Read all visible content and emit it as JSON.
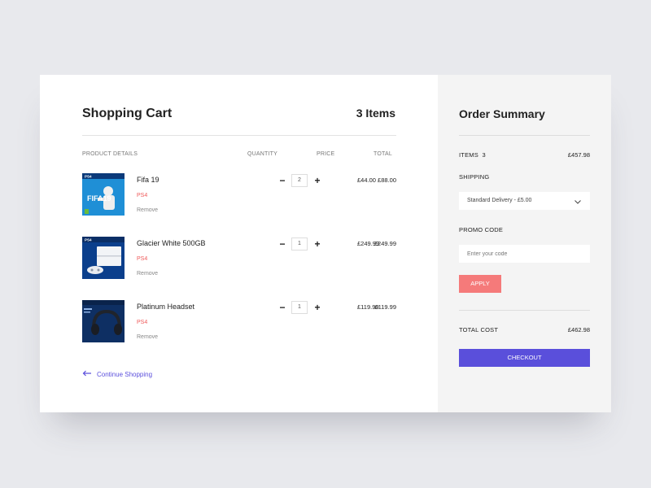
{
  "cart": {
    "title": "Shopping Cart",
    "item_count": "3 Items",
    "columns": {
      "details": "PRODUCT DETAILS",
      "quantity": "QUANTITY",
      "price": "PRICE",
      "total": "TOTAL"
    },
    "items": [
      {
        "name": "Fifa 19",
        "platform": "PS4",
        "remove": "Remove",
        "quantity": "2",
        "price": "£44.00",
        "total": "£88.00"
      },
      {
        "name": "Glacier White 500GB",
        "platform": "PS4",
        "remove": "Remove",
        "quantity": "1",
        "price": "£249.99",
        "total": "£249.99"
      },
      {
        "name": "Platinum Headset",
        "platform": "PS4",
        "remove": "Remove",
        "quantity": "1",
        "price": "£119.99",
        "total": "£119.99"
      }
    ],
    "continue_label": "Continue Shopping"
  },
  "summary": {
    "title": "Order Summary",
    "items_label": "ITEMS",
    "items_count": "3",
    "items_value": "£457.98",
    "shipping_label": "SHIPPING",
    "shipping_selected": "Standard Delivery  -  £5.00",
    "promo_label": "PROMO CODE",
    "promo_placeholder": "Enter your code",
    "apply_label": "APPLY",
    "total_label": "TOTAL COST",
    "total_value": "£462.98",
    "checkout_label": "CHECKOUT"
  },
  "colors": {
    "accent": "#5a4fdb",
    "platform": "#ef5b5b",
    "apply": "#f57a7a",
    "background": "#e8e9ed",
    "summary_panel": "#f4f4f4"
  },
  "icons": {
    "back": "arrow-left-icon",
    "dropdown": "chevron-down-icon",
    "minus": "minus-icon",
    "plus": "plus-icon"
  }
}
